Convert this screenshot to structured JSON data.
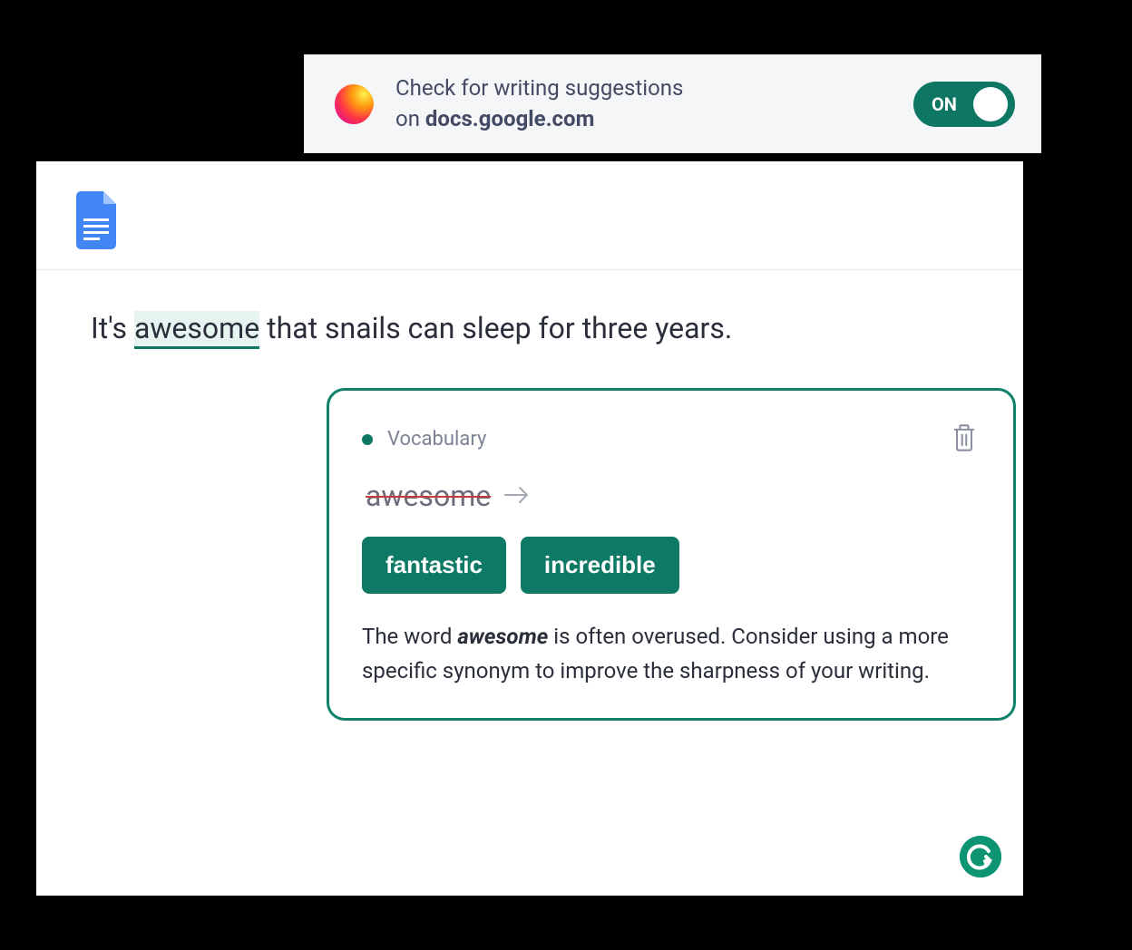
{
  "notification": {
    "line1": "Check for writing suggestions",
    "line2_prefix": "on ",
    "domain": "docs.google.com",
    "toggle_label": "ON"
  },
  "document": {
    "sentence_prefix": "It's ",
    "highlighted_word": "awesome",
    "sentence_suffix": " that snails can sleep for three years."
  },
  "suggestion_card": {
    "category": "Vocabulary",
    "strike_word": "awesome",
    "suggestions": [
      "fantastic",
      "incredible"
    ],
    "explanation_prefix": "The word ",
    "explanation_word": "awesome",
    "explanation_suffix": " is often overused. Consider using a more specific synonym to improve the sharpness of your writing."
  },
  "icons": {
    "grammarly_letter": "G"
  }
}
